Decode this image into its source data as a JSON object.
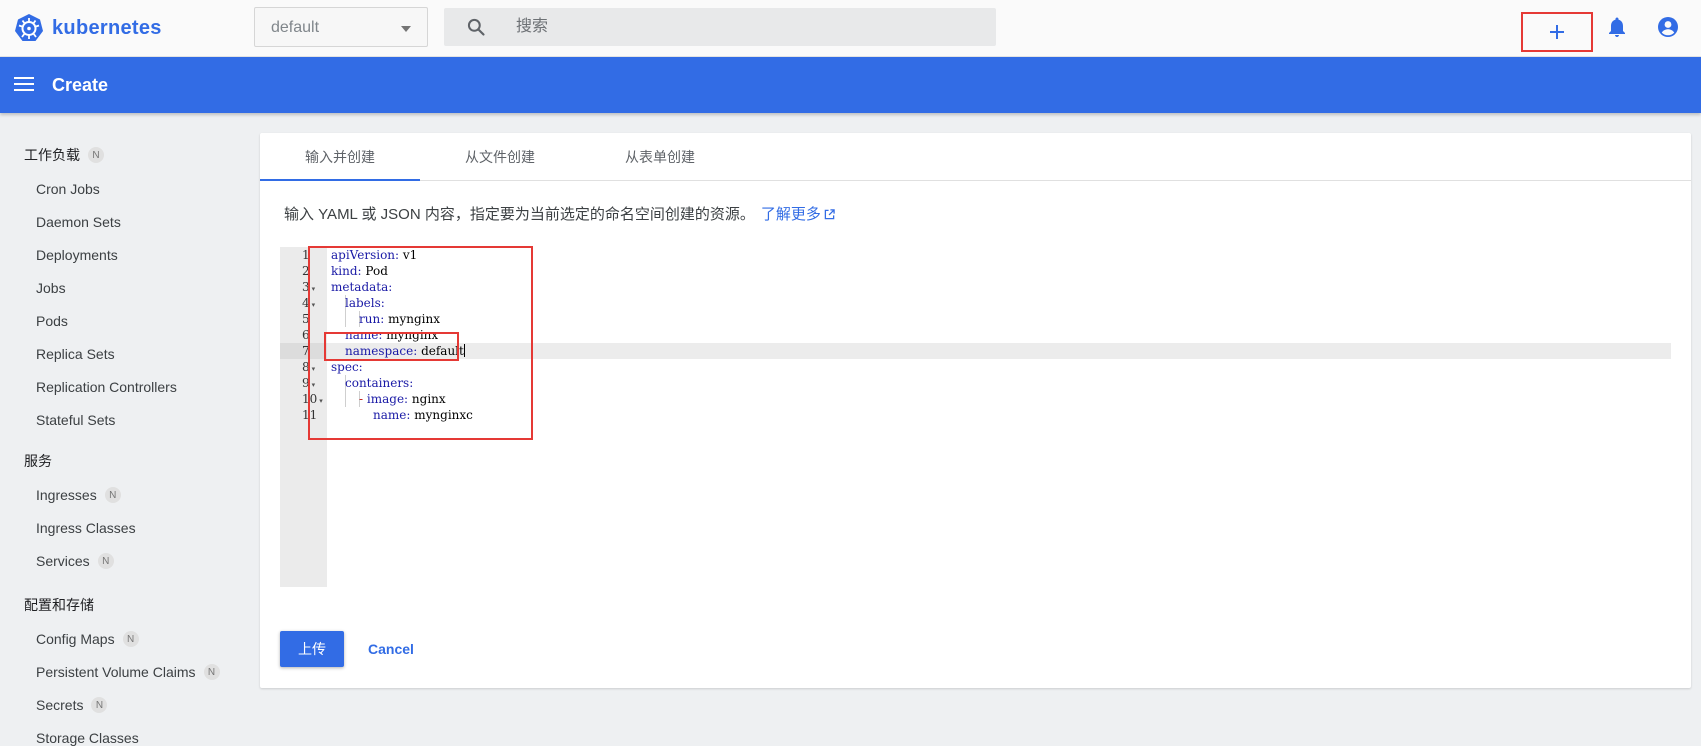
{
  "app": {
    "logo_text": "kubernetes",
    "brand_color": "#326ce5"
  },
  "topbar": {
    "namespace": "default",
    "search_placeholder": "搜索",
    "icons": [
      "kubernetes-logo-icon",
      "search-icon",
      "plus-icon",
      "bell-icon",
      "account-icon"
    ]
  },
  "header": {
    "title": "Create"
  },
  "sidebar": {
    "sections": [
      {
        "label": "工作负载",
        "badge": "N",
        "items": [
          {
            "label": "Cron Jobs"
          },
          {
            "label": "Daemon Sets"
          },
          {
            "label": "Deployments"
          },
          {
            "label": "Jobs"
          },
          {
            "label": "Pods"
          },
          {
            "label": "Replica Sets"
          },
          {
            "label": "Replication Controllers"
          },
          {
            "label": "Stateful Sets"
          }
        ]
      },
      {
        "label": "服务",
        "items": [
          {
            "label": "Ingresses",
            "badge": "N"
          },
          {
            "label": "Ingress Classes"
          },
          {
            "label": "Services",
            "badge": "N"
          }
        ]
      },
      {
        "label": "配置和存储",
        "items": [
          {
            "label": "Config Maps",
            "badge": "N"
          },
          {
            "label": "Persistent Volume Claims",
            "badge": "N"
          },
          {
            "label": "Secrets",
            "badge": "N"
          },
          {
            "label": "Storage Classes"
          }
        ]
      }
    ]
  },
  "tabs": [
    {
      "label": "输入并创建",
      "active": true
    },
    {
      "label": "从文件创建"
    },
    {
      "label": "从表单创建"
    }
  ],
  "description": "输入 YAML 或 JSON 内容，指定要为当前选定的命名空间创建的资源。",
  "learn_more": "了解更多",
  "editor": {
    "lines": [
      {
        "n": "1",
        "key": "apiVersion",
        "value": "v1"
      },
      {
        "n": "2",
        "key": "kind",
        "value": "Pod"
      },
      {
        "n": "3",
        "key": "metadata",
        "value": "",
        "fold": "▾"
      },
      {
        "n": "4",
        "key": "labels",
        "value": "",
        "fold": "▾"
      },
      {
        "n": "5",
        "key": "run",
        "value": "mynginx"
      },
      {
        "n": "6",
        "key": "name",
        "value": "mynginx"
      },
      {
        "n": "7",
        "key": "namespace",
        "value": "default"
      },
      {
        "n": "8",
        "key": "spec",
        "value": "",
        "fold": "▾"
      },
      {
        "n": "9",
        "key": "containers",
        "value": "",
        "fold": "▾"
      },
      {
        "n": "10",
        "dash": "-",
        "key": "image",
        "value": "nginx",
        "fold": "▾"
      },
      {
        "n": "11",
        "key": "name",
        "value": "mynginxc"
      }
    ]
  },
  "buttons": {
    "upload": "上传",
    "cancel": "Cancel"
  },
  "colors": {
    "highlight_box": "#e53935",
    "yaml_key": "#1a1aa6"
  }
}
